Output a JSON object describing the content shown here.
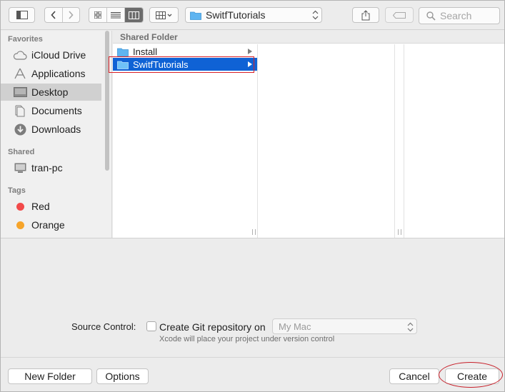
{
  "toolbar": {
    "path_label": "SwitfTutorials",
    "search_placeholder": "Search"
  },
  "sidebar": {
    "favorites_heading": "Favorites",
    "favorites": [
      {
        "label": "iCloud Drive",
        "icon": "cloud-icon"
      },
      {
        "label": "Applications",
        "icon": "applications-icon"
      },
      {
        "label": "Desktop",
        "icon": "desktop-icon",
        "selected": true
      },
      {
        "label": "Documents",
        "icon": "documents-icon"
      },
      {
        "label": "Downloads",
        "icon": "downloads-icon"
      }
    ],
    "shared_heading": "Shared",
    "shared": [
      {
        "label": "tran-pc",
        "icon": "computer-icon"
      }
    ],
    "tags_heading": "Tags",
    "tags": [
      {
        "label": "Red",
        "color": "#f24a4a"
      },
      {
        "label": "Orange",
        "color": "#f6a42a"
      }
    ]
  },
  "browser": {
    "column_heading": "Shared Folder",
    "items": [
      {
        "name": "Install",
        "selected": false
      },
      {
        "name": "SwitfTutorials",
        "selected": true
      }
    ]
  },
  "source_control": {
    "label": "Source Control:",
    "checkbox_label": "Create Git repository on",
    "checked": false,
    "location_value": "My Mac",
    "hint": "Xcode will place your project under version control"
  },
  "buttons": {
    "new_folder": "New Folder",
    "options": "Options",
    "cancel": "Cancel",
    "create": "Create"
  },
  "colors": {
    "selection": "#0f62d5",
    "folder": "#5fb4f0",
    "highlight_annotation": "#d81f26"
  }
}
